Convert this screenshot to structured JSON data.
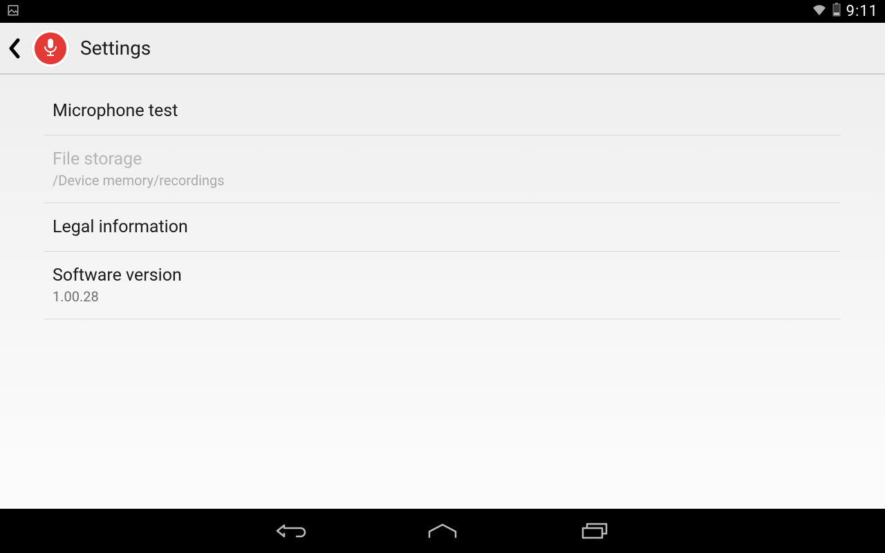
{
  "status": {
    "time": "9:11"
  },
  "header": {
    "title": "Settings"
  },
  "settings": [
    {
      "title": "Microphone test",
      "subtitle": null,
      "enabled": true
    },
    {
      "title": "File storage",
      "subtitle": "/Device memory/recordings",
      "enabled": false
    },
    {
      "title": "Legal information",
      "subtitle": null,
      "enabled": true
    },
    {
      "title": "Software version",
      "subtitle": "1.00.28",
      "enabled": true
    }
  ]
}
